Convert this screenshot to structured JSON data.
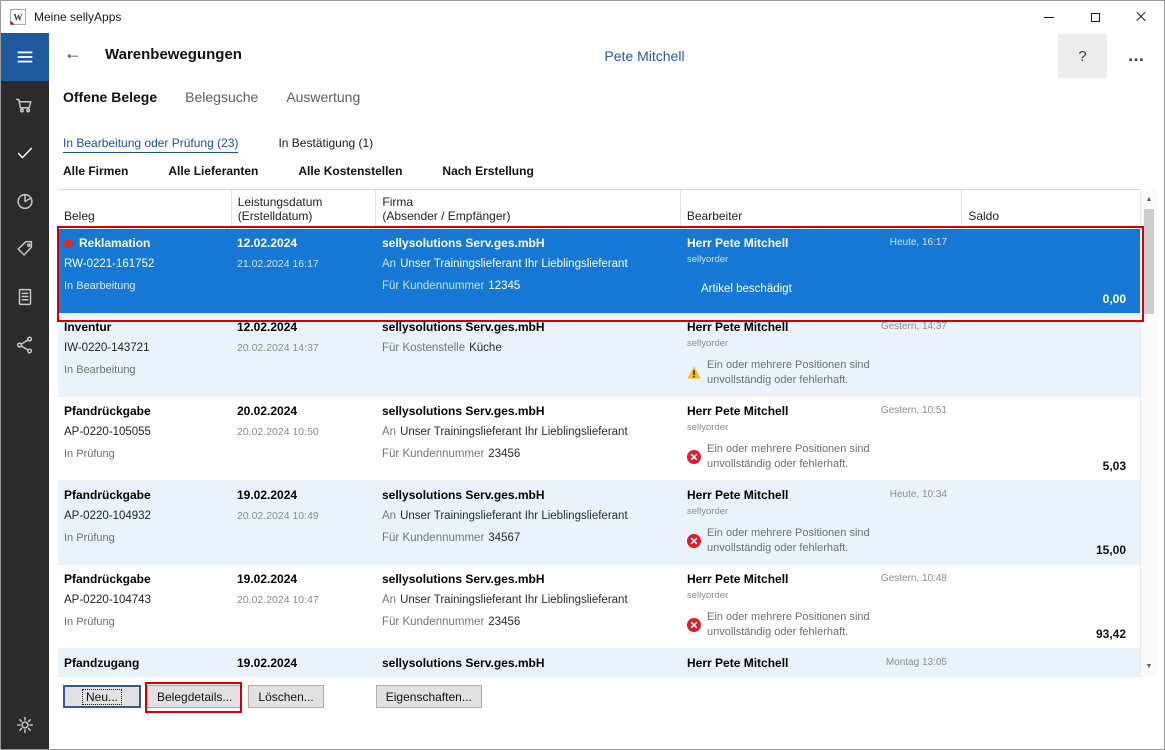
{
  "colors": {
    "accent_blue": "#1478d4",
    "row_alt_blue": "#eaf3fc",
    "link_blue": "#1d4f9e",
    "sidebar_dark": "#2b2b2b",
    "menu_blue": "#1d5a9e",
    "annotation_red": "#d60000",
    "warning_yellow": "#fdb913",
    "error_red": "#e01b2c",
    "status_dot_red": "#e8251f"
  },
  "window": {
    "title": "Meine sellyApps"
  },
  "sidebar": {
    "nav_items": [
      {
        "icon": "cart",
        "active": false
      },
      {
        "icon": "checkmark",
        "active": true
      },
      {
        "icon": "pie-chart",
        "active": false
      },
      {
        "icon": "price-tag",
        "active": false
      },
      {
        "icon": "ledger",
        "active": false
      },
      {
        "icon": "share-network",
        "active": false
      }
    ]
  },
  "header": {
    "title": "Warenbewegungen",
    "user": "Pete Mitchell",
    "help_label": "?",
    "more_label": "…"
  },
  "tabs": [
    {
      "label": "Offene Belege",
      "active": true
    },
    {
      "label": "Belegsuche",
      "active": false
    },
    {
      "label": "Auswertung",
      "active": false
    }
  ],
  "subtabs": [
    {
      "label": "In Bearbeitung oder Prüfung (23)",
      "active": true
    },
    {
      "label": "In Bestätigung (1)",
      "active": false
    }
  ],
  "filters": [
    {
      "label": "Alle Firmen"
    },
    {
      "label": "Alle Lieferanten"
    },
    {
      "label": "Alle Kostenstellen"
    },
    {
      "label": "Nach Erstellung"
    }
  ],
  "table": {
    "columns": [
      {
        "line1": "Beleg",
        "line2": ""
      },
      {
        "line1": "Leistungsdatum",
        "line2": "(Erstelldatum)"
      },
      {
        "line1": "Firma",
        "line2": "(Absender / Empfänger)"
      },
      {
        "line1": "Bearbeiter",
        "line2": ""
      },
      {
        "line1": "Saldo",
        "line2": ""
      }
    ],
    "rows": [
      {
        "style": "selected",
        "beleg": {
          "dot": true,
          "type": "Reklamation",
          "number": "RW-0221-161752",
          "status": "In Bearbeitung"
        },
        "datum": {
          "date": "12.02.2024",
          "created": "21.02.2024 16:17"
        },
        "firma": {
          "name": "sellysolutions Serv.ges.mbH",
          "lines": [
            {
              "label": "An",
              "value": "Unser Trainingslieferant Ihr Lieblingslieferant"
            },
            {
              "label": "Für Kundennummer",
              "value": "12345"
            }
          ]
        },
        "bearbeiter": {
          "name": "Herr Pete Mitchell",
          "app": "sellyorder",
          "time": "Heute, 16:17",
          "message_icon": "none",
          "message": "Artikel beschädigt"
        },
        "saldo": "0,00"
      },
      {
        "style": "alt",
        "beleg": {
          "dot": false,
          "type": "Inventur",
          "number": "IW-0220-143721",
          "status": "In Bearbeitung"
        },
        "datum": {
          "date": "12.02.2024",
          "created": "20.02.2024 14:37"
        },
        "firma": {
          "name": "sellysolutions Serv.ges.mbH",
          "lines": [
            {
              "label": "Für Kostenstelle",
              "value": "Küche"
            }
          ]
        },
        "bearbeiter": {
          "name": "Herr Pete Mitchell",
          "app": "sellyorder",
          "time": "Gestern, 14:37",
          "message_icon": "warning",
          "message": "Ein oder mehrere Positionen sind unvollständig oder fehlerhaft."
        },
        "saldo": ""
      },
      {
        "style": "plain",
        "beleg": {
          "dot": false,
          "type": "Pfandrückgabe",
          "number": "AP-0220-105055",
          "status": "In Prüfung"
        },
        "datum": {
          "date": "20.02.2024",
          "created": "20.02.2024 10:50"
        },
        "firma": {
          "name": "sellysolutions Serv.ges.mbH",
          "lines": [
            {
              "label": "An",
              "value": "Unser Trainingslieferant Ihr Lieblingslieferant"
            },
            {
              "label": "Für Kundennummer",
              "value": "23456"
            }
          ]
        },
        "bearbeiter": {
          "name": "Herr Pete Mitchell",
          "app": "sellyorder",
          "time": "Gestern, 10:51",
          "message_icon": "error",
          "message": "Ein oder mehrere Positionen sind unvollständig oder fehlerhaft."
        },
        "saldo": "5,03"
      },
      {
        "style": "alt",
        "beleg": {
          "dot": false,
          "type": "Pfandrückgabe",
          "number": "AP-0220-104932",
          "status": "In Prüfung"
        },
        "datum": {
          "date": "19.02.2024",
          "created": "20.02.2024 10:49"
        },
        "firma": {
          "name": "sellysolutions Serv.ges.mbH",
          "lines": [
            {
              "label": "An",
              "value": "Unser Trainingslieferant Ihr Lieblingslieferant"
            },
            {
              "label": "Für Kundennummer",
              "value": "34567"
            }
          ]
        },
        "bearbeiter": {
          "name": "Herr Pete Mitchell",
          "app": "sellyorder",
          "time": "Heute, 10:34",
          "message_icon": "error",
          "message": "Ein oder mehrere Positionen sind unvollständig oder fehlerhaft."
        },
        "saldo": "15,00"
      },
      {
        "style": "plain",
        "beleg": {
          "dot": false,
          "type": "Pfandrückgabe",
          "number": "AP-0220-104743",
          "status": "In Prüfung"
        },
        "datum": {
          "date": "19.02.2024",
          "created": "20.02.2024 10:47"
        },
        "firma": {
          "name": "sellysolutions Serv.ges.mbH",
          "lines": [
            {
              "label": "An",
              "value": "Unser Trainingslieferant Ihr Lieblingslieferant"
            },
            {
              "label": "Für Kundennummer",
              "value": "23456"
            }
          ]
        },
        "bearbeiter": {
          "name": "Herr Pete Mitchell",
          "app": "sellyorder",
          "time": "Gestern, 10:48",
          "message_icon": "error",
          "message": "Ein oder mehrere Positionen sind unvollständig oder fehlerhaft."
        },
        "saldo": "93,42"
      },
      {
        "style": "alt",
        "beleg": {
          "dot": false,
          "type": "Pfandzugang",
          "number": "",
          "status": ""
        },
        "datum": {
          "date": "19.02.2024",
          "created": ""
        },
        "firma": {
          "name": "sellysolutions Serv.ges.mbH",
          "lines": []
        },
        "bearbeiter": {
          "name": "Herr Pete Mitchell",
          "app": "",
          "time": "Montag 13:05",
          "message_icon": "none",
          "message": ""
        },
        "saldo": ""
      }
    ]
  },
  "footer_buttons": [
    {
      "label": "Neu...",
      "focused": true
    },
    {
      "label": "Belegdetails...",
      "annotated": true
    },
    {
      "label": "Löschen...",
      "focused": false
    },
    {
      "label": "Eigenschaften...",
      "focused": false
    }
  ],
  "annotations": [
    {
      "target": "selected-row"
    },
    {
      "target": "belegdetails-button"
    }
  ]
}
